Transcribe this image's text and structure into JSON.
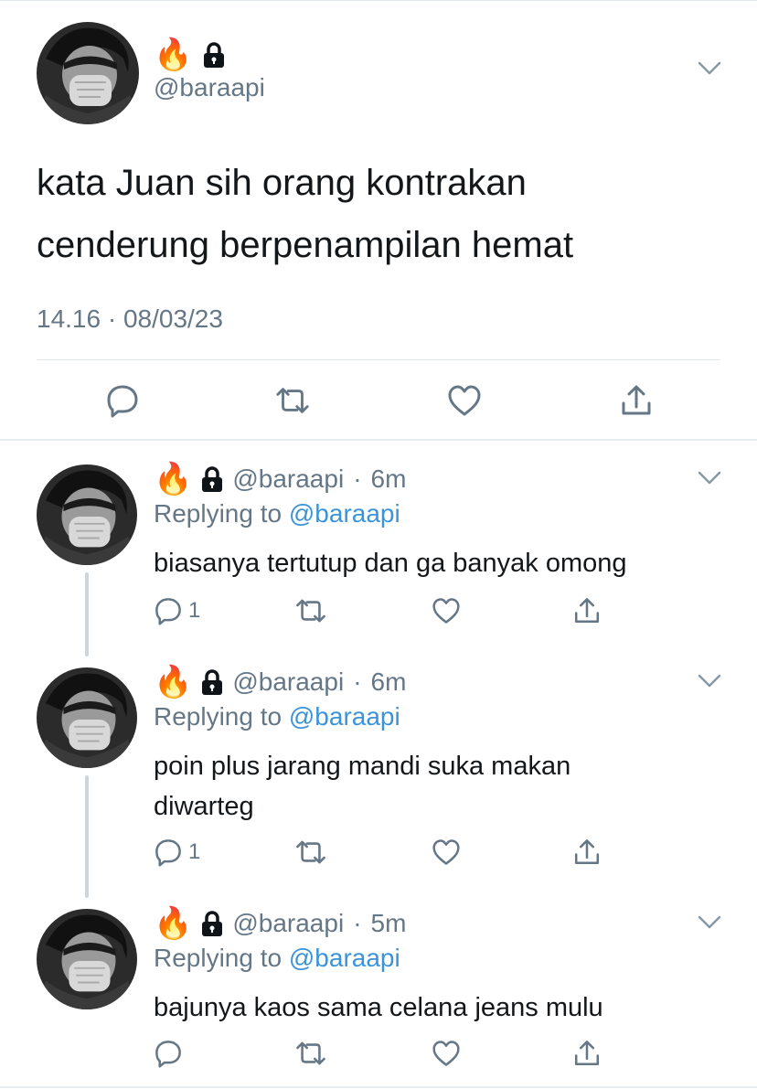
{
  "icons": {
    "fire": "🔥",
    "lock": "lock-icon",
    "chevron": "chevron-down-icon",
    "reply": "reply-icon",
    "retweet": "retweet-icon",
    "like": "heart-icon",
    "share": "share-icon"
  },
  "colors": {
    "text": "#14171a",
    "secondary": "#657786",
    "link": "#3b94d9",
    "divider": "#e1e8ed",
    "thread": "#ccd6dd"
  },
  "main_tweet": {
    "handle": "@baraapi",
    "text_line1": "kata Juan sih orang kontrakan",
    "text_line2": "cenderung berpenampilan hemat",
    "timestamp": "14.16 · 08/03/23"
  },
  "replies": [
    {
      "handle": "@baraapi",
      "time": "6m",
      "replying_prefix": "Replying to",
      "replying_to": "@baraapi",
      "text": "biasanya tertutup dan ga banyak omong",
      "reply_count": "1"
    },
    {
      "handle": "@baraapi",
      "time": "6m",
      "replying_prefix": "Replying to",
      "replying_to": "@baraapi",
      "text": "poin plus jarang mandi suka makan diwarteg",
      "reply_count": "1"
    },
    {
      "handle": "@baraapi",
      "time": "5m",
      "replying_prefix": "Replying to",
      "replying_to": "@baraapi",
      "text": "bajunya kaos sama celana jeans mulu",
      "reply_count": ""
    }
  ],
  "separator": "·"
}
